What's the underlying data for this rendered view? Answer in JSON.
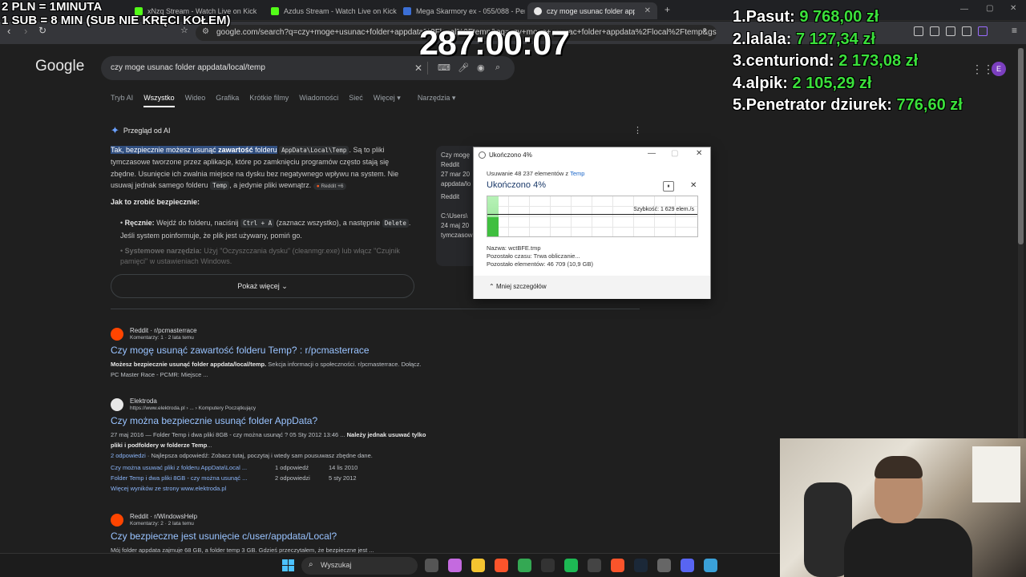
{
  "overlay": {
    "rate_line": "2 PLN = 1MINUTA",
    "sub_line": "1 SUB = 8 MIN (SUB NIE KRĘCI KOŁEM)",
    "timer": "287:00:07",
    "leaderboard": [
      {
        "rank": "1.",
        "name": "Pasut:",
        "amount": "9 768,00 zł"
      },
      {
        "rank": "2.",
        "name": "lalala:",
        "amount": "7 127,34 zł"
      },
      {
        "rank": "3.",
        "name": "centuriond:",
        "amount": "2 173,08 zł"
      },
      {
        "rank": "4.",
        "name": "alpik:",
        "amount": "2 105,29 zł"
      },
      {
        "rank": "5.",
        "name": "Penetrator dziurek:",
        "amount": "776,60 zł"
      }
    ]
  },
  "browser": {
    "tabs": [
      {
        "label": "xNzq Stream - Watch Live on Kick",
        "color": "#53fc18"
      },
      {
        "label": "Azdus Stream - Watch Live on Kick",
        "color": "#53fc18"
      },
      {
        "label": "Mega Skarmory ex - 055/088 - Perfect",
        "color": "#3b6fd6"
      },
      {
        "label": "czy moge usunac folder appdata",
        "color": "#e8e8e8"
      }
    ],
    "new_tab": "+",
    "url": "google.com/search?q=czy+moge+usunac+folder+appdata%2Flocal%2Ftemp&oq=czy+moge+usunac+folder+appdata%2Flocal%2Ftemp&gs_..."
  },
  "google": {
    "logo": "Google",
    "query": "czy moge usunac folder appdata/local/temp",
    "tabs": [
      "Tryb AI",
      "Wszystko",
      "Wideo",
      "Grafika",
      "Krótkie filmy",
      "Wiadomości",
      "Sieć",
      "Więcej ▾",
      "Narzędzia ▾"
    ],
    "avatar_letter": "E",
    "ai_overview": {
      "heading": "Przegląd od AI",
      "p1_highlight_a": "Tak, bezpiecznie możesz usunąć ",
      "p1_highlight_b": "zawartość",
      "p1_highlight_c": " folderu",
      "p1_code": "AppData\\Local\\Temp",
      "p1_rest": ". Są to pliki tymczasowe tworzone przez aplikacje, które po zamknięciu programów często stają się zbędne. Usunięcie ich zwalnia miejsce na dysku bez negatywnego wpływu na system. Nie usuwaj jednak samego folderu",
      "p1_code2": "Temp",
      "p1_end": ", a jedynie pliki wewnątrz.",
      "p1_source": "Reddit +6",
      "how_heading": "Jak to zrobić bezpiecznie:",
      "b1_label": "Ręcznie:",
      "b1_text_a": " Wejdź do folderu, naciśnij ",
      "b1_code": "Ctrl + A",
      "b1_text_b": " (zaznacz wszystko), a następnie ",
      "b1_code2": "Delete",
      "b1_text_c": ". Jeśli system poinformuje, że plik jest używany, pomiń go.",
      "b2_label": "Systemowe narzędzia:",
      "b2_text": " Użyj \"Oczyszczania dysku\" (cleanmgr.exe) lub włącz \"Czujnik pamięci\" w ustawieniach Windows.",
      "show_more": "Pokaż więcej",
      "peek_lines": [
        "Czy mogę",
        "Reddit",
        "27 mar 20",
        "appdata/lo",
        "Reddit",
        "C:\\Users\\",
        "24 maj 20",
        "tymczasow"
      ]
    },
    "results": [
      {
        "site": "Reddit · r/pcmasterrace",
        "sub": "Komentarzy: 1 · 2 lata temu",
        "title": "Czy mogę usunąć zawartość folderu Temp? : r/pcmasterrace",
        "snippet_b": "Możesz bezpiecznie usunąć folder appdata/local/temp.",
        "snippet": " Sekcja informacji o społeczności. r/pcmasterrace. Dołącz. PC Master Race - PCMR: Miejsce ..."
      },
      {
        "site": "Elektroda",
        "sub": "https://www.elektroda.pl › ... › Komputery Początkujący",
        "title": "Czy można bezpiecznie usunąć folder AppData?",
        "snippet": "27 maj 2016 — Folder Temp i dwa pliki 8GB - czy można usunąć ? 05 Sty 2012 13:46 ... ",
        "snippet_b": "Należy jednak usuwać tylko pliki i podfoldery w folderze Temp",
        "snippet_end": "...",
        "answers_label": "2 odpowiedzi",
        "answers_text": " · Najlepsza odpowiedź: Zobacz tutaj, poczytaj i wtedy sam pousuwasz zbędne dane.",
        "sub1_title": "Czy można usuwać pliki z folderu AppData\\Local ...",
        "sub1_count": "1 odpowiedź",
        "sub1_date": "14 lis 2010",
        "sub2_title": "Folder Temp i dwa pliki 8GB - czy można usunąć ...",
        "sub2_count": "2 odpowiedzi",
        "sub2_date": "5 sty 2012",
        "more": "Więcej wyników ze strony www.elektroda.pl"
      },
      {
        "site": "Reddit · r/WindowsHelp",
        "sub": "Komentarzy: 2 · 2 lata temu",
        "title": "Czy bezpieczne jest usunięcie c/user/appdata/Local?",
        "snippet": "Mój folder appdata zajmuje 68 GB, a folder temp 3 GB. Gdzieś przeczytałem, że bezpieczne jest ..."
      }
    ]
  },
  "dialog": {
    "title": "Ukończono 4%",
    "description_a": "Usuwanie 48 237 elementów z ",
    "description_link": "Temp",
    "percent": "Ukończono 4%",
    "progress_fraction": 0.04,
    "speed": "Szybkość: 1 629 elem./s",
    "name": "Nazwa:  wctBFE.tmp",
    "time_left": "Pozostało czasu:  Trwa obliczanie...",
    "items_left": "Pozostało elementów:  46 709 (10,9 GB)",
    "less_details": "Mniej szczegółów",
    "pause_glyph": "⏸",
    "cancel_glyph": "✕"
  },
  "taskbar": {
    "search_placeholder": "Wyszukaj",
    "apps": [
      {
        "name": "task-view",
        "color": "#555"
      },
      {
        "name": "copilot",
        "color": "#c46adf"
      },
      {
        "name": "file-explorer",
        "color": "#f4c430"
      },
      {
        "name": "brave",
        "color": "#fb542b"
      },
      {
        "name": "chrome",
        "color": "#34a853"
      },
      {
        "name": "obs",
        "color": "#333"
      },
      {
        "name": "spotify",
        "color": "#1db954"
      },
      {
        "name": "muza",
        "color": "#444"
      },
      {
        "name": "brave-beta",
        "color": "#fb542b"
      },
      {
        "name": "steam",
        "color": "#1b2838"
      },
      {
        "name": "calculator",
        "color": "#666"
      },
      {
        "name": "discord",
        "color": "#5865f2"
      },
      {
        "name": "notepad",
        "color": "#3aa0d8"
      }
    ]
  }
}
